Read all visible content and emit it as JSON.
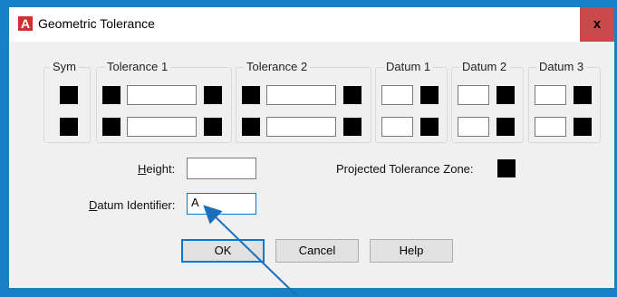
{
  "window": {
    "title": "Geometric Tolerance",
    "close_label": "x",
    "app_icon": "autocad-a-icon"
  },
  "groups": {
    "sym": "Sym",
    "tolerance1": "Tolerance 1",
    "tolerance2": "Tolerance 2",
    "datum1": "Datum 1",
    "datum2": "Datum 2",
    "datum3": "Datum 3"
  },
  "height": {
    "label_prefix": "",
    "label_key": "H",
    "label_rest": "eight:",
    "value": ""
  },
  "datum_identifier": {
    "label_key": "D",
    "label_rest": "atum Identifier:",
    "value": "A"
  },
  "projected": {
    "label": "Projected Tolerance Zone:"
  },
  "buttons": {
    "ok": "OK",
    "cancel": "Cancel",
    "help": "Help"
  },
  "colors": {
    "titlebar": "#ffffff",
    "close": "#c94a4a",
    "background": "#1681c7",
    "annotation_arrow": "#1a6fb8"
  }
}
